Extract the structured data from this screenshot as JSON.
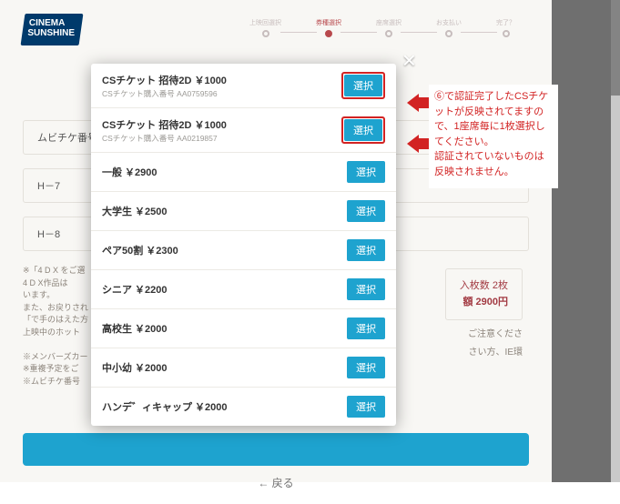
{
  "logo": {
    "line1": "CINEMA",
    "line2": "SUNSHINE"
  },
  "stepper": {
    "steps": [
      "上映回選択",
      "券種選択",
      "座席選択",
      "お支払い",
      "完了？"
    ],
    "active_index": 1
  },
  "page_title": "券種選択",
  "sections": {
    "mvticket": "ムビチケ番号",
    "seat1": "H－7",
    "seat2": "H－8"
  },
  "summary": {
    "line1_suffix": "入枚数 2枚",
    "line2_suffix": "額 2900円",
    "foot1": "ご注意くださ",
    "foot2": "さい方、IE環"
  },
  "notes": "※「4 D X をご選\n4 D X作品は\nいます。\nまた、お戻りされ\n「で手のはえた方\n上映中のホット\n\n※メンバーズカー\n※重複予定をご\n※ムビチケ番号",
  "back_label": "← 戻る",
  "modal": {
    "select_label": "選択",
    "tickets": [
      {
        "name": "CSチケット 招待2D ￥1000",
        "sub": "CSチケット購入番号 AA0759596",
        "hl": true
      },
      {
        "name": "CSチケット 招待2D ￥1000",
        "sub": "CSチケット購入番号 AA0219857",
        "hl": true
      },
      {
        "name": "一般 ￥2900"
      },
      {
        "name": "大学生 ￥2500"
      },
      {
        "name": "ペア50割 ￥2300"
      },
      {
        "name": "シニア ￥2200"
      },
      {
        "name": "高校生 ￥2000"
      },
      {
        "name": "中小幼 ￥2000"
      },
      {
        "name": "ハンデ゛ィキャップ ￥2000"
      }
    ]
  },
  "instruction": "⑥で認証完了したCSチケットが反映されてますので、1座席毎に1枚選択してください。\n認証されていないものは反映されません。"
}
